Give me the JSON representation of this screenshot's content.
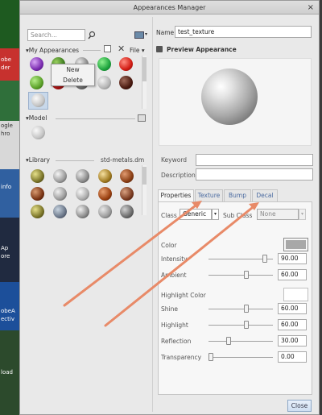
{
  "window": {
    "title": "Appearances Manager",
    "close_glyph": "×"
  },
  "desktop": {
    "labels": [
      "obe",
      "der",
      "ogle",
      "hro",
      "info",
      "Ap",
      "ore",
      "obeA",
      "ectiv",
      "load"
    ]
  },
  "search": {
    "placeholder": "Search..."
  },
  "toolbar": {
    "file_label": "File ▾"
  },
  "my_appearances": {
    "label": "My Appearances"
  },
  "context_menu": {
    "items": [
      "New",
      "Delete"
    ]
  },
  "model": {
    "label": "Model"
  },
  "library": {
    "label": "Library",
    "source": "std-metals.dm"
  },
  "name": {
    "label": "Name",
    "value": "test_texture"
  },
  "preview": {
    "label": "Preview Appearance"
  },
  "keyword": {
    "label": "Keyword",
    "value": ""
  },
  "description": {
    "label": "Description",
    "value": ""
  },
  "tabs": [
    "Properties",
    "Texture",
    "Bump",
    "Decal"
  ],
  "class_row": {
    "class_label": "Class",
    "class_value": "Generic",
    "subclass_label": "Sub Class",
    "subclass_value": "None"
  },
  "properties": {
    "color_label": "Color",
    "highlight_color_label": "Highlight Color",
    "sliders": [
      {
        "label": "Intensity",
        "value": "90.00",
        "level": 0.9
      },
      {
        "label": "Ambient",
        "value": "60.00",
        "level": 0.6
      },
      {
        "label": "Shine",
        "value": "60.00",
        "level": 0.6
      },
      {
        "label": "Highlight",
        "value": "60.00",
        "level": 0.6
      },
      {
        "label": "Reflection",
        "value": "30.00",
        "level": 0.3
      },
      {
        "label": "Transparency",
        "value": "0.00",
        "level": 0.0
      }
    ]
  },
  "close_button": "Close",
  "colors": {
    "arrow": "#e88a68",
    "color_swatch": "#a8a8a8"
  }
}
